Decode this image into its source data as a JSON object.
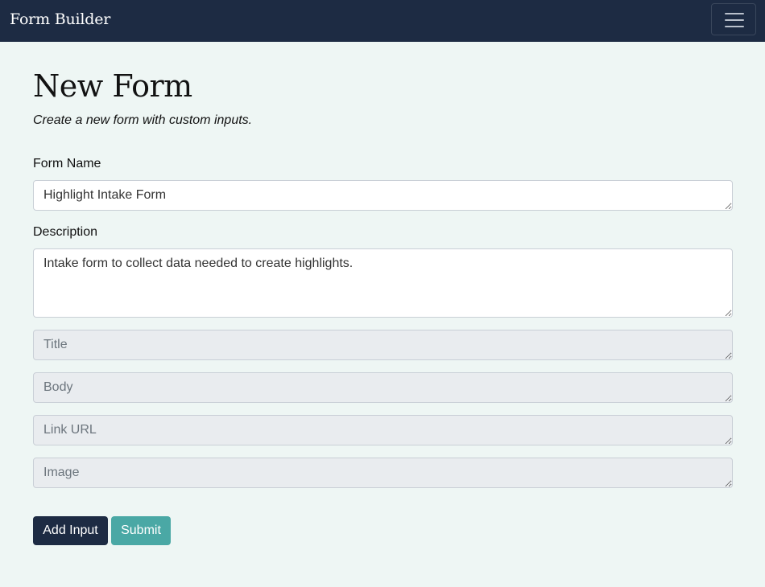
{
  "navbar": {
    "brand": "Form Builder",
    "menu_icon": "hamburger-menu-icon"
  },
  "page": {
    "title": "New Form",
    "subtitle": "Create a new form with custom inputs."
  },
  "form": {
    "name_label": "Form Name",
    "name_value": "Highlight Intake Form",
    "description_label": "Description",
    "description_value": "Intake form to collect data needed to create highlights.",
    "inputs": [
      {
        "placeholder": "Title"
      },
      {
        "placeholder": "Body"
      },
      {
        "placeholder": "Link URL"
      },
      {
        "placeholder": "Image"
      }
    ]
  },
  "actions": {
    "add_input_label": "Add Input",
    "submit_label": "Submit"
  },
  "colors": {
    "navbar_bg": "#1d2b43",
    "page_bg": "#eef6f4",
    "primary_button": "#1d2b43",
    "submit_button": "#4aa8a5",
    "disabled_field_bg": "#e9ecef"
  }
}
